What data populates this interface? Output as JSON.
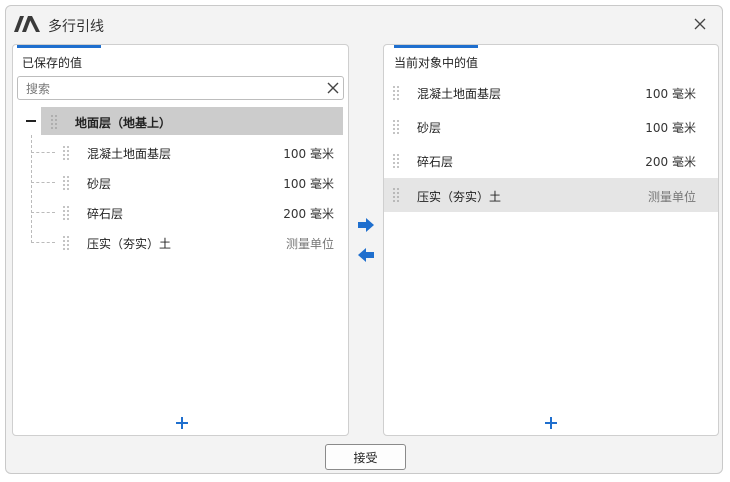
{
  "window": {
    "title": "多行引线",
    "logo_icon": "autodesk-logo-icon",
    "close_icon": "close-icon"
  },
  "left_panel": {
    "title": "已保存的值",
    "search": {
      "placeholder": "搜索",
      "value": ""
    },
    "group": {
      "label": "地面层（地基上）",
      "expanded": true
    },
    "items": [
      {
        "label": "混凝土地面基层",
        "value": "100 毫米",
        "muted": false
      },
      {
        "label": "砂层",
        "value": "100 毫米",
        "muted": false
      },
      {
        "label": "碎石层",
        "value": "200 毫米",
        "muted": false
      },
      {
        "label": "压实（夯实）土",
        "value": "测量单位",
        "muted": true
      }
    ],
    "add_icon": "plus-icon"
  },
  "transfer": {
    "right_icon": "arrow-right-icon",
    "left_icon": "arrow-left-icon"
  },
  "right_panel": {
    "title": "当前对象中的值",
    "items": [
      {
        "label": "混凝土地面基层",
        "value": "100 毫米",
        "muted": false,
        "selected": false
      },
      {
        "label": "砂层",
        "value": "100 毫米",
        "muted": false,
        "selected": false
      },
      {
        "label": "碎石层",
        "value": "200 毫米",
        "muted": false,
        "selected": false
      },
      {
        "label": "压实（夯实）土",
        "value": "测量单位",
        "muted": true,
        "selected": true
      }
    ],
    "add_icon": "plus-icon"
  },
  "footer": {
    "accept_label": "接受"
  },
  "colors": {
    "accent": "#1f6fce",
    "selected_row": "#e5e5e5",
    "group_row": "#cccccc",
    "dialog_bg": "#f3f3f3"
  }
}
